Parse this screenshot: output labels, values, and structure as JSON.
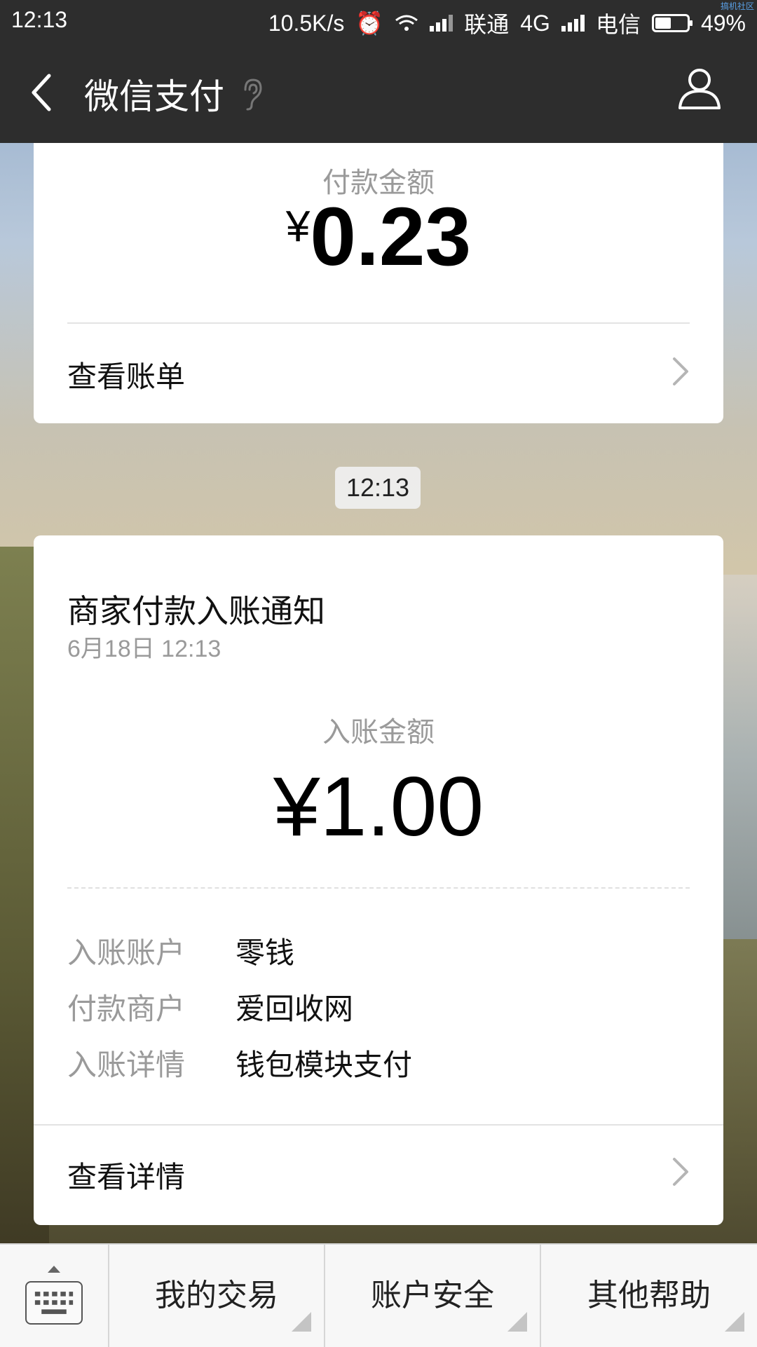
{
  "status_bar": {
    "time": "12:13",
    "speed": "10.5K/s",
    "carrier1": "联通",
    "network": "4G",
    "carrier2": "电信",
    "battery": "49%",
    "battery_level": 0.49,
    "watermark": "搞机社区"
  },
  "nav": {
    "title": "微信支付",
    "icons": [
      "back-icon",
      "ear-icon",
      "profile-icon"
    ]
  },
  "payment_card": {
    "label": "付款金额",
    "currency": "¥",
    "amount": "0.23",
    "link": "查看账单"
  },
  "timestamp": "12:13",
  "notice_card": {
    "title": "商家付款入账通知",
    "date": "6月18日  12:13",
    "label": "入账金额",
    "amount": "¥1.00",
    "details": [
      {
        "key": "入账账户",
        "value": "零钱"
      },
      {
        "key": "付款商户",
        "value": "爱回收网"
      },
      {
        "key": "入账详情",
        "value": "钱包模块支付"
      }
    ],
    "link": "查看详情"
  },
  "bottom_menu": {
    "items": [
      "我的交易",
      "账户安全",
      "其他帮助"
    ]
  },
  "colors": {
    "header_bg": "#2d2d2d",
    "muted_text": "#9a9a9a",
    "card_bg": "#ffffff"
  }
}
